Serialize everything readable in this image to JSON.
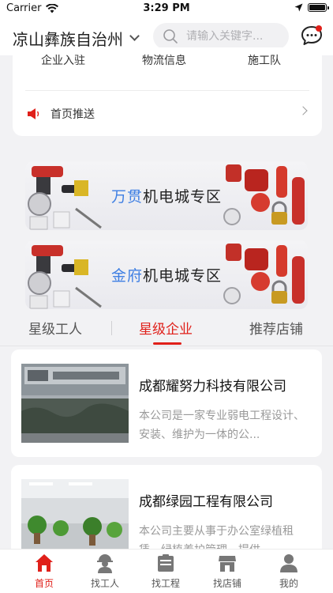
{
  "status_bar": {
    "carrier": "Carrier",
    "time": "3:29 PM"
  },
  "header": {
    "city": "凉山彝族自治州",
    "search_placeholder": "请输入关键字..."
  },
  "quick_links": [
    "企业入驻",
    "物流信息",
    "施工队"
  ],
  "notice": {
    "label": "首页推送"
  },
  "banners": [
    {
      "highlight": "万贯",
      "rest": "机电城专区"
    },
    {
      "highlight": "金府",
      "rest": "机电城专区"
    }
  ],
  "tabs": [
    {
      "label": "星级工人"
    },
    {
      "label": "星级企业"
    },
    {
      "label": "推荐店铺"
    }
  ],
  "companies": [
    {
      "name": "成都耀努力科技有限公司",
      "description": "本公司是一家专业弱电工程设计、安装、维护为一体的公..."
    },
    {
      "name": "成都绿园工程有限公司",
      "description": "本公司主要从事于办公室绿植租赁、绿植养护管理、提供"
    }
  ],
  "tabbar": [
    {
      "label": "首页",
      "icon": "home-icon"
    },
    {
      "label": "找工人",
      "icon": "worker-icon"
    },
    {
      "label": "找工程",
      "icon": "project-icon"
    },
    {
      "label": "找店铺",
      "icon": "store-icon"
    },
    {
      "label": "我的",
      "icon": "profile-icon"
    }
  ],
  "colors": {
    "accent": "#e0201a",
    "highlight_blue": "#3f7fe3"
  }
}
